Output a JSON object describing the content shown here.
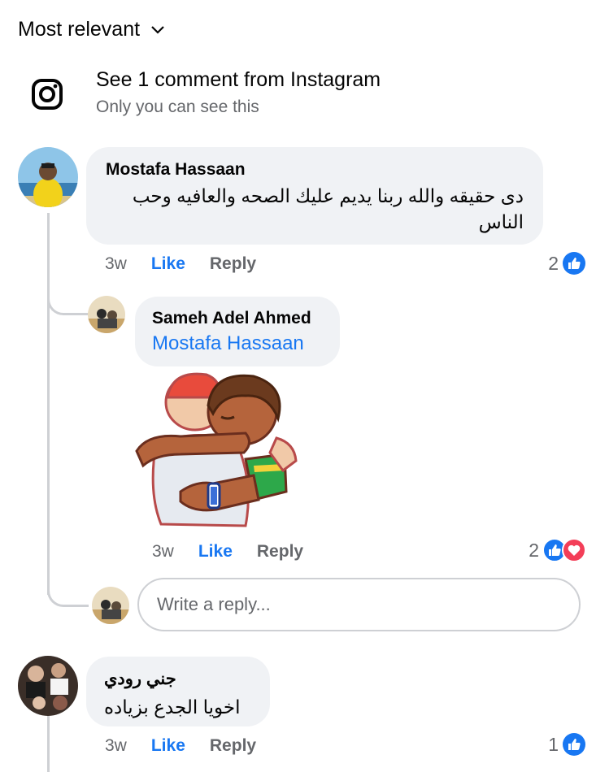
{
  "sort": {
    "label": "Most relevant"
  },
  "instagram_notice": {
    "title": "See 1 comment from Instagram",
    "subtitle": "Only you can see this"
  },
  "comments": [
    {
      "author": "Mostafa Hassaan",
      "text": "دى حقيقه والله ربنا يديم عليك الصحه والعافيه وحب الناس",
      "time": "3w",
      "like": "Like",
      "reply": "Reply",
      "reaction_count": "2",
      "reactions": [
        "like-icon"
      ],
      "replies": [
        {
          "author": "Sameh Adel Ahmed",
          "mention": "Mostafa Hassaan",
          "sticker": "hug-sticker",
          "time": "3w",
          "like": "Like",
          "reply": "Reply",
          "reaction_count": "2",
          "reactions": [
            "like-icon",
            "love-icon"
          ]
        }
      ],
      "reply_box": {
        "placeholder": "Write a reply..."
      }
    },
    {
      "author": "جني رودي",
      "text": "اخويا الجدع بزياده",
      "time": "3w",
      "like": "Like",
      "reply": "Reply",
      "reaction_count": "1",
      "reactions": [
        "like-icon"
      ]
    }
  ],
  "colors": {
    "accent": "#1877f2",
    "love": "#f33e58",
    "bubble": "#f0f2f5",
    "muted": "#65676b"
  }
}
